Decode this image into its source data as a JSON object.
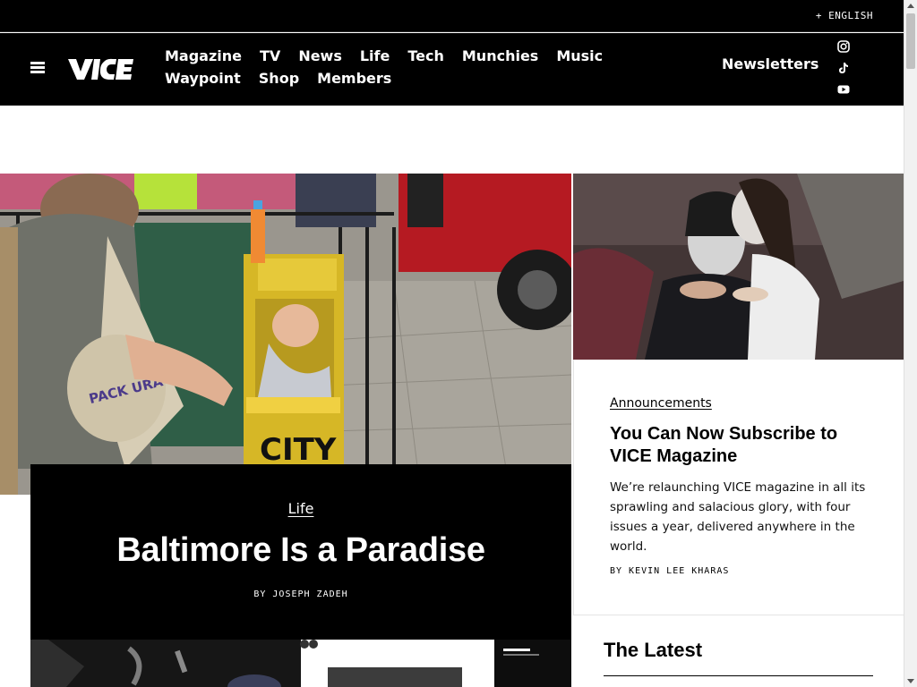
{
  "language": {
    "label": "+ ENGLISH"
  },
  "nav": {
    "menu_icon": "hamburger-icon",
    "logo_icon": "vice-logo",
    "links": [
      "Magazine",
      "TV",
      "News",
      "Life",
      "Tech",
      "Munchies",
      "Music",
      "Waypoint",
      "Shop",
      "Members"
    ],
    "newsletters": "Newsletters",
    "social": [
      "instagram-icon",
      "tiktok-icon",
      "youtube-icon"
    ]
  },
  "hero": {
    "image": "street-festival-photo",
    "category": "Life",
    "title": "Baltimore Is a Paradise",
    "byline": "BY JOSEPH ZADEH"
  },
  "side_article": {
    "image": "facepaint-couple-photo",
    "category": "Announcements",
    "title": "You Can Now Subscribe to VICE Magazine",
    "description": "We’re relaunching VICE magazine in all its sprawling and salacious glory, with four issues a year, delivered anywhere in the world.",
    "byline": "BY KEVIN LEE KHARAS"
  },
  "latest": {
    "title": "The Latest"
  },
  "colors": {
    "nav_bg": "#000000",
    "accent": "#ffffff"
  }
}
